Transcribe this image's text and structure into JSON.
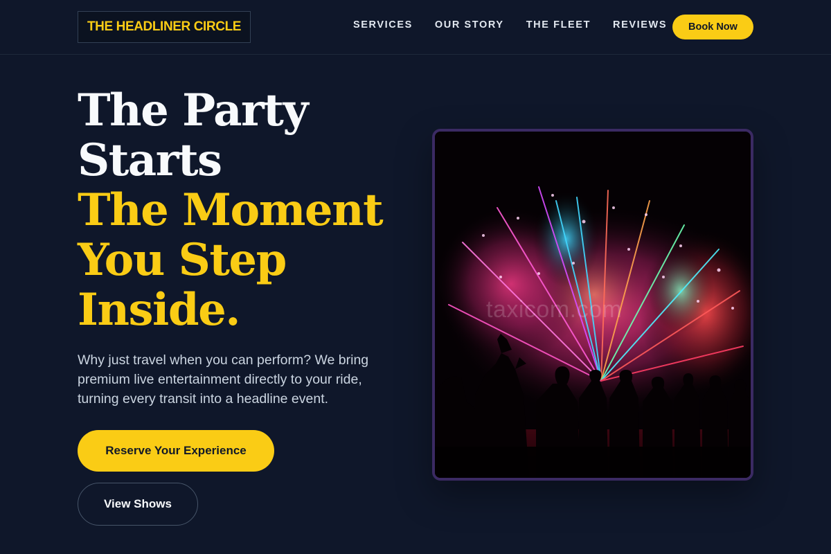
{
  "header": {
    "logo": "THE HEADLINER CIRCLE",
    "nav": [
      {
        "label": "SERVICES"
      },
      {
        "label": "OUR STORY"
      },
      {
        "label": "THE FLEET"
      },
      {
        "label": "REVIEWS"
      }
    ],
    "cta_label": "Book Now"
  },
  "hero": {
    "title_white": [
      "The Party",
      "Starts"
    ],
    "title_gold": [
      "The Moment",
      "You Step",
      "Inside."
    ],
    "body": "Why just travel when you can perform? We bring premium live entertainment directly to your ride, turning every transit into a headline event.",
    "primary_label": "Reserve Your Experience",
    "secondary_label": "View Shows"
  },
  "image": {
    "watermark": "taxicom.com"
  },
  "colors": {
    "background": "#0f172a",
    "accent": "#facc15",
    "frame": "#3b2a63"
  }
}
